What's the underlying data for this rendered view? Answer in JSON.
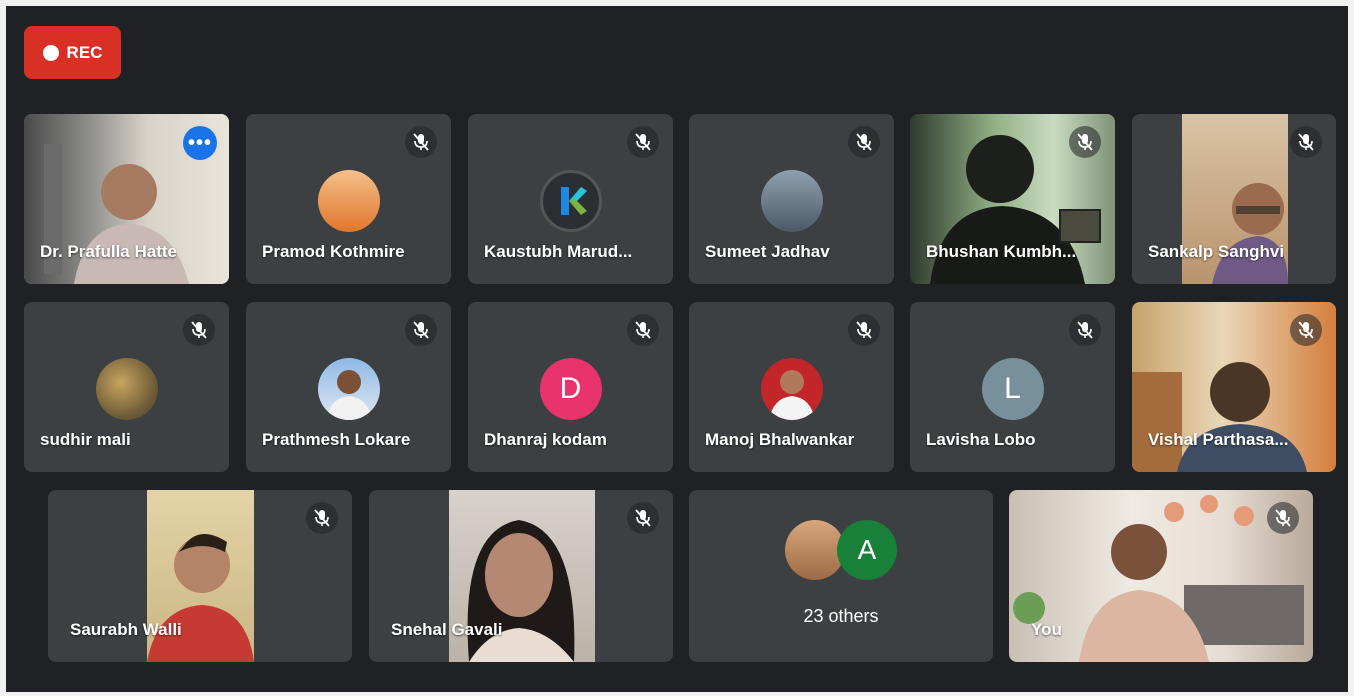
{
  "recording": {
    "label": "REC"
  },
  "participants": {
    "prafulla": {
      "name": "Dr. Prafulla Hatte"
    },
    "pramod": {
      "name": "Pramod Kothmire"
    },
    "kaustubh": {
      "name": "Kaustubh Marud..."
    },
    "sumeet": {
      "name": "Sumeet Jadhav"
    },
    "bhushan": {
      "name": "Bhushan Kumbh..."
    },
    "sankalp": {
      "name": "Sankalp Sanghvi"
    },
    "sudhir": {
      "name": "sudhir mali"
    },
    "prathmesh": {
      "name": "Prathmesh Lokare"
    },
    "dhanraj": {
      "name": "Dhanraj kodam",
      "initial": "D"
    },
    "manoj": {
      "name": "Manoj Bhalwankar"
    },
    "lavisha": {
      "name": "Lavisha Lobo",
      "initial": "L"
    },
    "vishal": {
      "name": "Vishal Parthasa..."
    },
    "saurabh": {
      "name": "Saurabh Walli"
    },
    "snehal": {
      "name": "Snehal Gavali"
    },
    "you": {
      "name": "You"
    }
  },
  "others": {
    "label": "23 others",
    "initial": "A"
  },
  "icons": {
    "mic_off": "mic-off-icon",
    "more": "more-options-icon",
    "rec": "record-dot-icon"
  },
  "colors": {
    "background": "#202124",
    "tile": "#3c4043",
    "rec": "#d93025",
    "active_border": "#8ab4f8"
  }
}
